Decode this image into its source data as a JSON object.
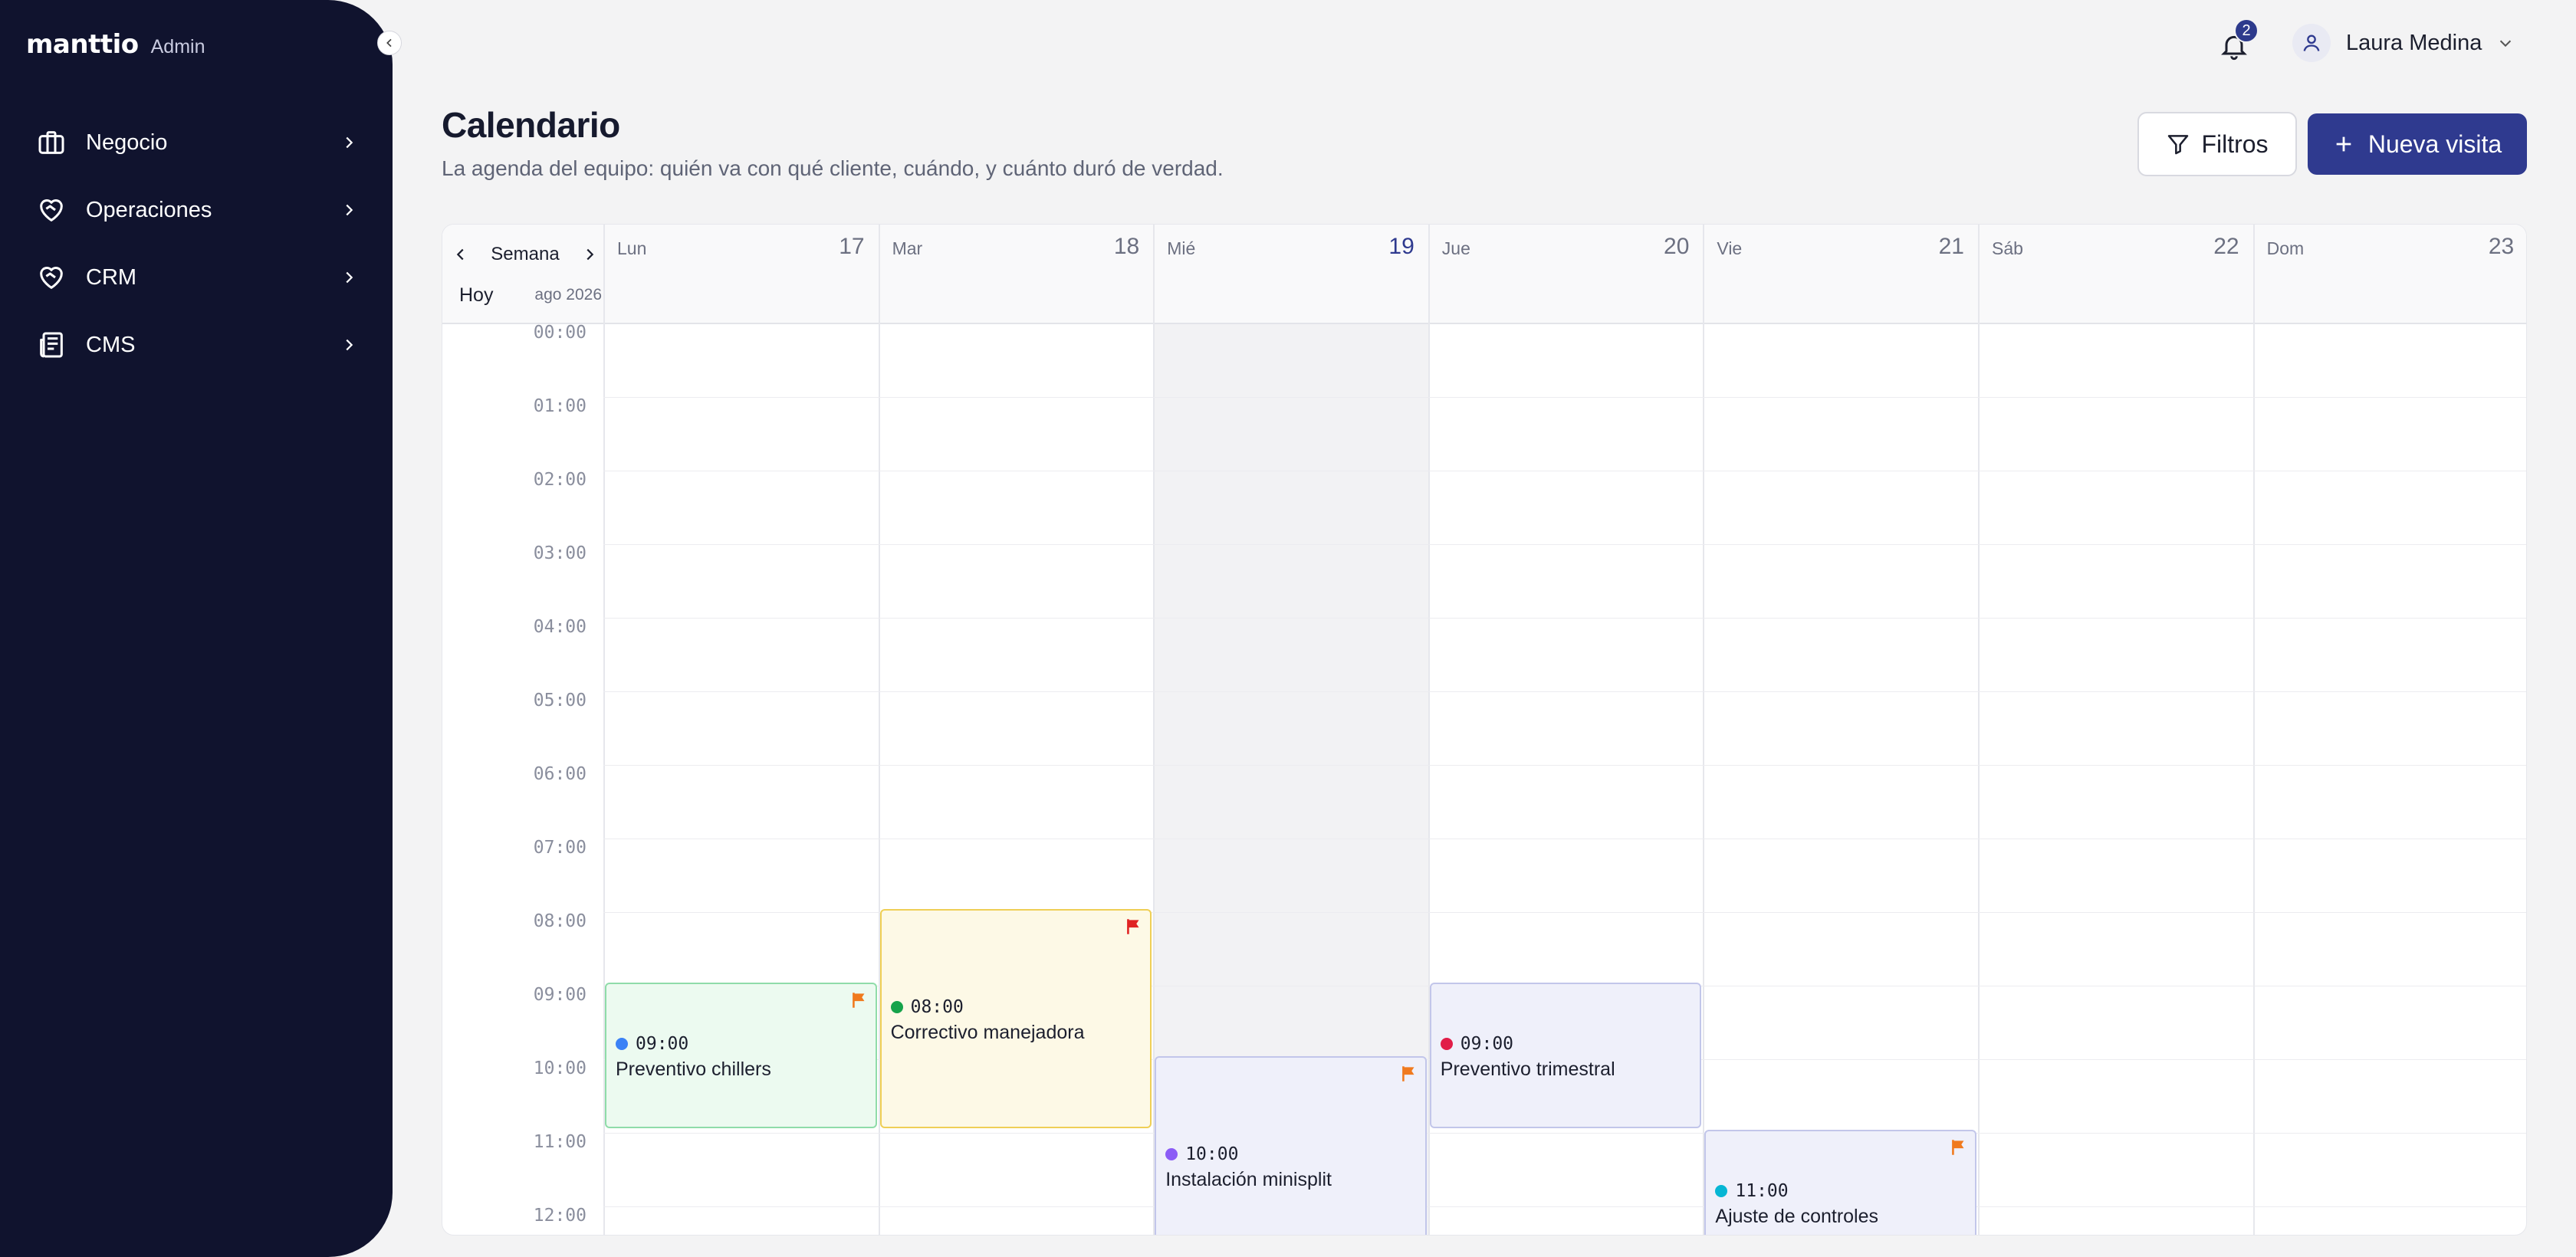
{
  "app": {
    "brand": "manttio",
    "brand_tag": "Admin"
  },
  "sidebar": {
    "items": [
      {
        "label": "Negocio",
        "icon": "briefcase-icon"
      },
      {
        "label": "Operaciones",
        "icon": "heart-handshake-icon"
      },
      {
        "label": "CRM",
        "icon": "heart-handshake-icon"
      },
      {
        "label": "CMS",
        "icon": "newspaper-icon"
      }
    ]
  },
  "topbar": {
    "notifications_count": "2",
    "user_name": "Laura Medina"
  },
  "header": {
    "title": "Calendario",
    "subtitle": "La agenda del equipo: quién va con qué cliente, cuándo, y cuánto duró de verdad.",
    "filter_label": "Filtros",
    "new_label": "Nueva visita"
  },
  "calendar": {
    "view_label": "Semana",
    "today_label": "Hoy",
    "month_label": "ago 2026",
    "days": [
      {
        "name": "Lun",
        "num": "17",
        "today": false
      },
      {
        "name": "Mar",
        "num": "18",
        "today": false
      },
      {
        "name": "Mié",
        "num": "19",
        "today": true
      },
      {
        "name": "Jue",
        "num": "20",
        "today": false
      },
      {
        "name": "Vie",
        "num": "21",
        "today": false
      },
      {
        "name": "Sáb",
        "num": "22",
        "today": false
      },
      {
        "name": "Dom",
        "num": "23",
        "today": false
      }
    ],
    "hours": [
      "00:00",
      "01:00",
      "02:00",
      "03:00",
      "04:00",
      "05:00",
      "06:00",
      "07:00",
      "08:00",
      "09:00",
      "10:00",
      "11:00",
      "12:00"
    ],
    "events": [
      {
        "day": 0,
        "start": 9,
        "end": 11,
        "time": "09:00",
        "title": "Preventivo chillers",
        "dot": "#3b82f6",
        "bg": "#ecfaf0",
        "border": "#8fdca9",
        "flag": "#f07a1e"
      },
      {
        "day": 1,
        "start": 8,
        "end": 11,
        "time": "08:00",
        "title": "Correctivo manejadora",
        "dot": "#16a34a",
        "bg": "#fdf9e6",
        "border": "#efcf55",
        "flag": "#e02424"
      },
      {
        "day": 2,
        "start": 10,
        "end": 13,
        "time": "10:00",
        "title": "Instalación minisplit",
        "dot": "#8b5cf6",
        "bg": "#eff0fa",
        "border": "#c2c6ea",
        "flag": "#f07a1e"
      },
      {
        "day": 3,
        "start": 9,
        "end": 11,
        "time": "09:00",
        "title": "Preventivo trimestral",
        "dot": "#e11d48",
        "bg": "#eff0fa",
        "border": "#c2c6ea",
        "flag": ""
      },
      {
        "day": 4,
        "start": 11,
        "end": 13,
        "time": "11:00",
        "title": "Ajuste de controles",
        "dot": "#06b6d4",
        "bg": "#eff0fa",
        "border": "#c2c6ea",
        "flag": "#f07a1e"
      }
    ]
  }
}
